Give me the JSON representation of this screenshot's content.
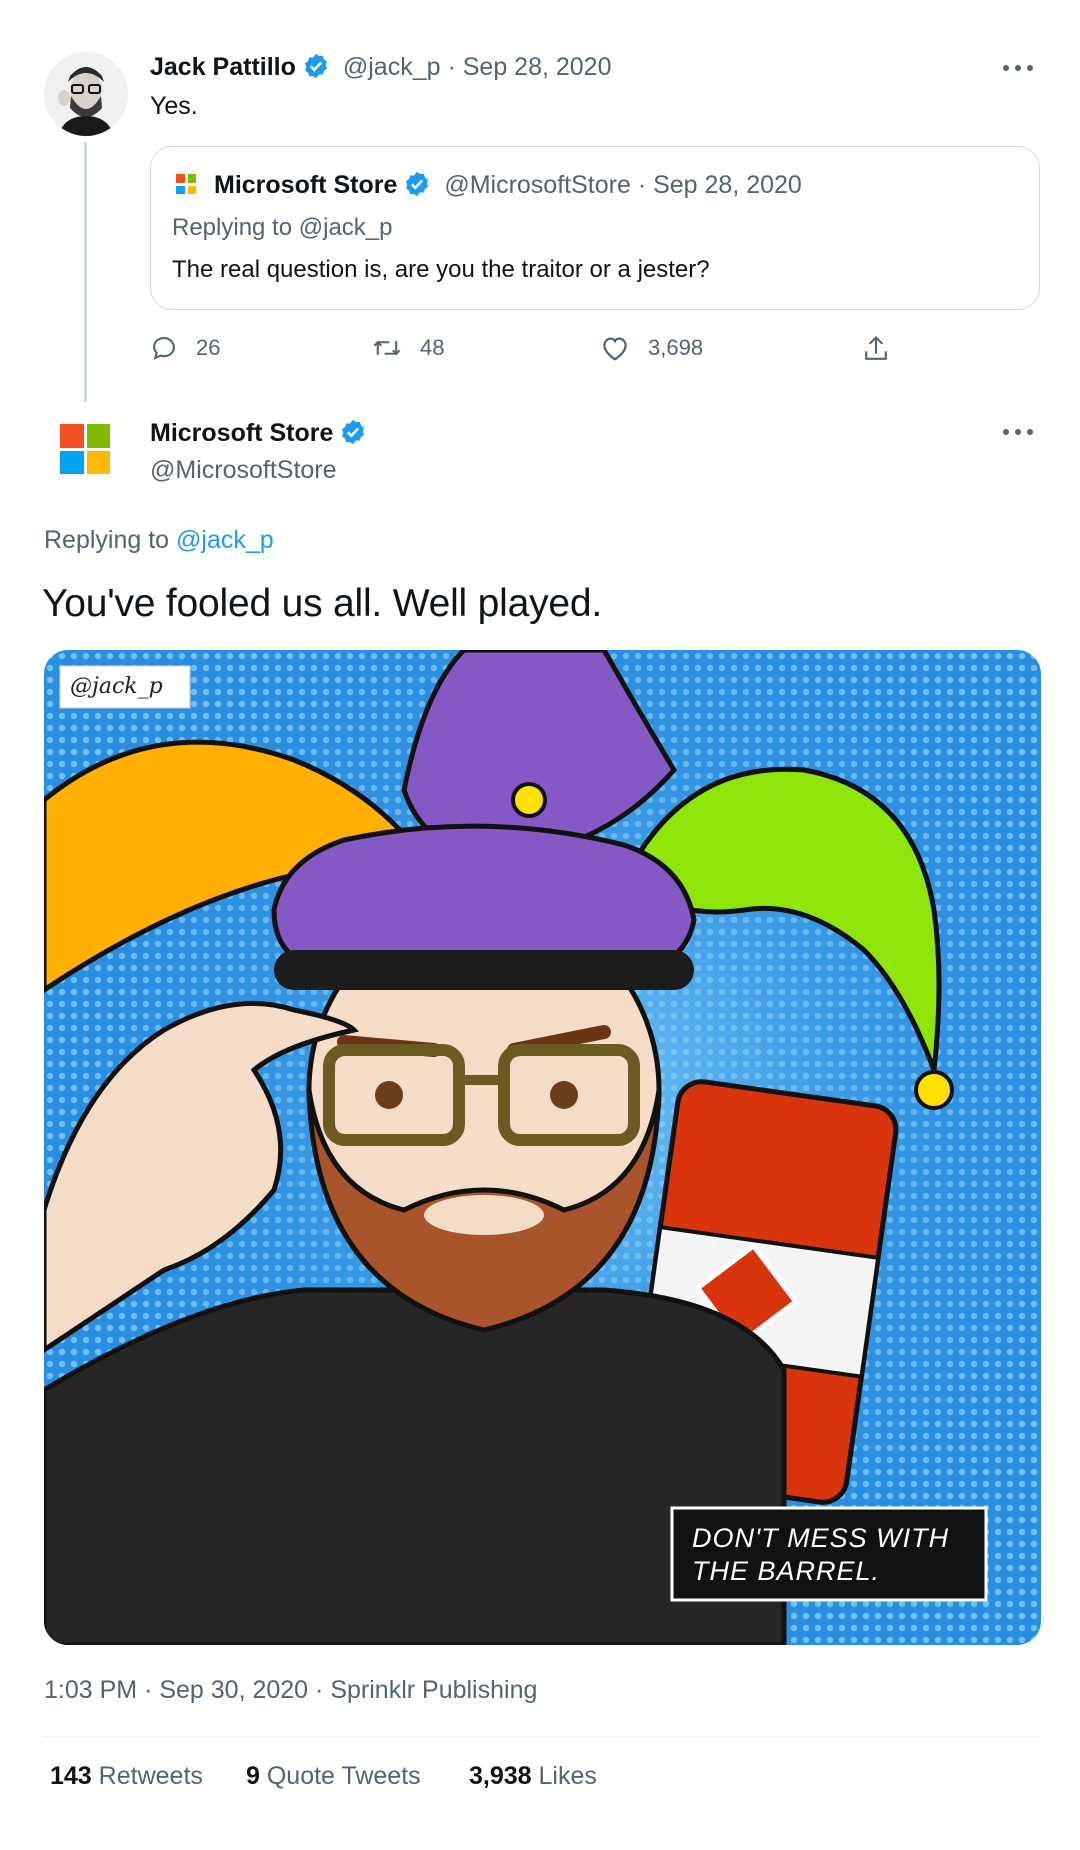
{
  "tweet_parent": {
    "author_name": "Jack Pattillo",
    "author_handle": "@jack_p",
    "separator": "·",
    "date": "Sep 28, 2020",
    "text": "Yes.",
    "quoted": {
      "author_name": "Microsoft Store",
      "author_handle": "@MicrosoftStore",
      "separator": "·",
      "date": "Sep 28, 2020",
      "replying_prefix": "Replying to",
      "replying_handle": "@jack_p",
      "text": "The real question is, are you the traitor or a jester?"
    },
    "actions": {
      "replies": "26",
      "retweets": "48",
      "likes": "3,698"
    }
  },
  "tweet_main": {
    "author_name": "Microsoft Store",
    "author_handle": "@MicrosoftStore",
    "replying_prefix": "Replying to",
    "replying_handle": "@jack_p",
    "text": "You've fooled us all. Well played.",
    "image": {
      "tag": "@jack_p",
      "caption_line1": "DON'T MESS WITH",
      "caption_line2": "THE BARREL."
    },
    "meta": {
      "time": "1:03 PM",
      "separator": "·",
      "date": "Sep 30, 2020",
      "source": "Sprinklr Publishing"
    },
    "stats": {
      "retweets_count": "143",
      "retweets_label": "Retweets",
      "quotes_count": "9",
      "quotes_label": "Quote Tweets",
      "likes_count": "3,938",
      "likes_label": "Likes"
    }
  },
  "colors": {
    "accent": "#1d9bf0",
    "text": "#0f1419",
    "muted": "#536471",
    "border": "#cfd9de",
    "ms_red": "#f25022",
    "ms_green": "#7fba00",
    "ms_blue": "#00a4ef",
    "ms_yellow": "#ffb900"
  }
}
